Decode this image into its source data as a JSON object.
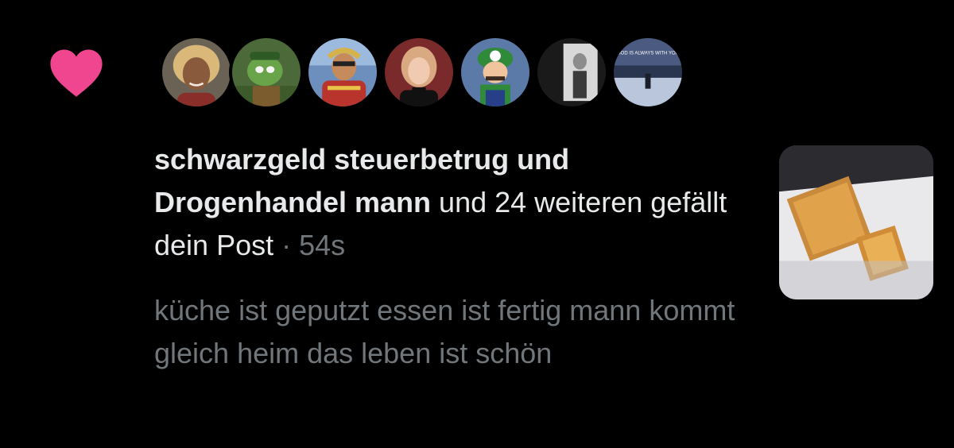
{
  "notification": {
    "type_icon": "heart-icon",
    "accent_color": "#f91880",
    "avatars": [
      {
        "name": "avatar-1"
      },
      {
        "name": "avatar-2"
      },
      {
        "name": "avatar-3"
      },
      {
        "name": "avatar-4"
      },
      {
        "name": "avatar-5"
      },
      {
        "name": "avatar-6"
      },
      {
        "name": "avatar-7",
        "caption": "GOD IS ALWAYS WITH YOU"
      }
    ],
    "actor_name": "schwarzgeld steuerbetrug und Drogenhandel mann",
    "rest_text": "und 24 weiteren gefällt dein Post",
    "separator": "·",
    "time": "54s",
    "post_text": "küche ist geputzt essen ist fertig mann kommt gleich heim das leben ist schön"
  }
}
